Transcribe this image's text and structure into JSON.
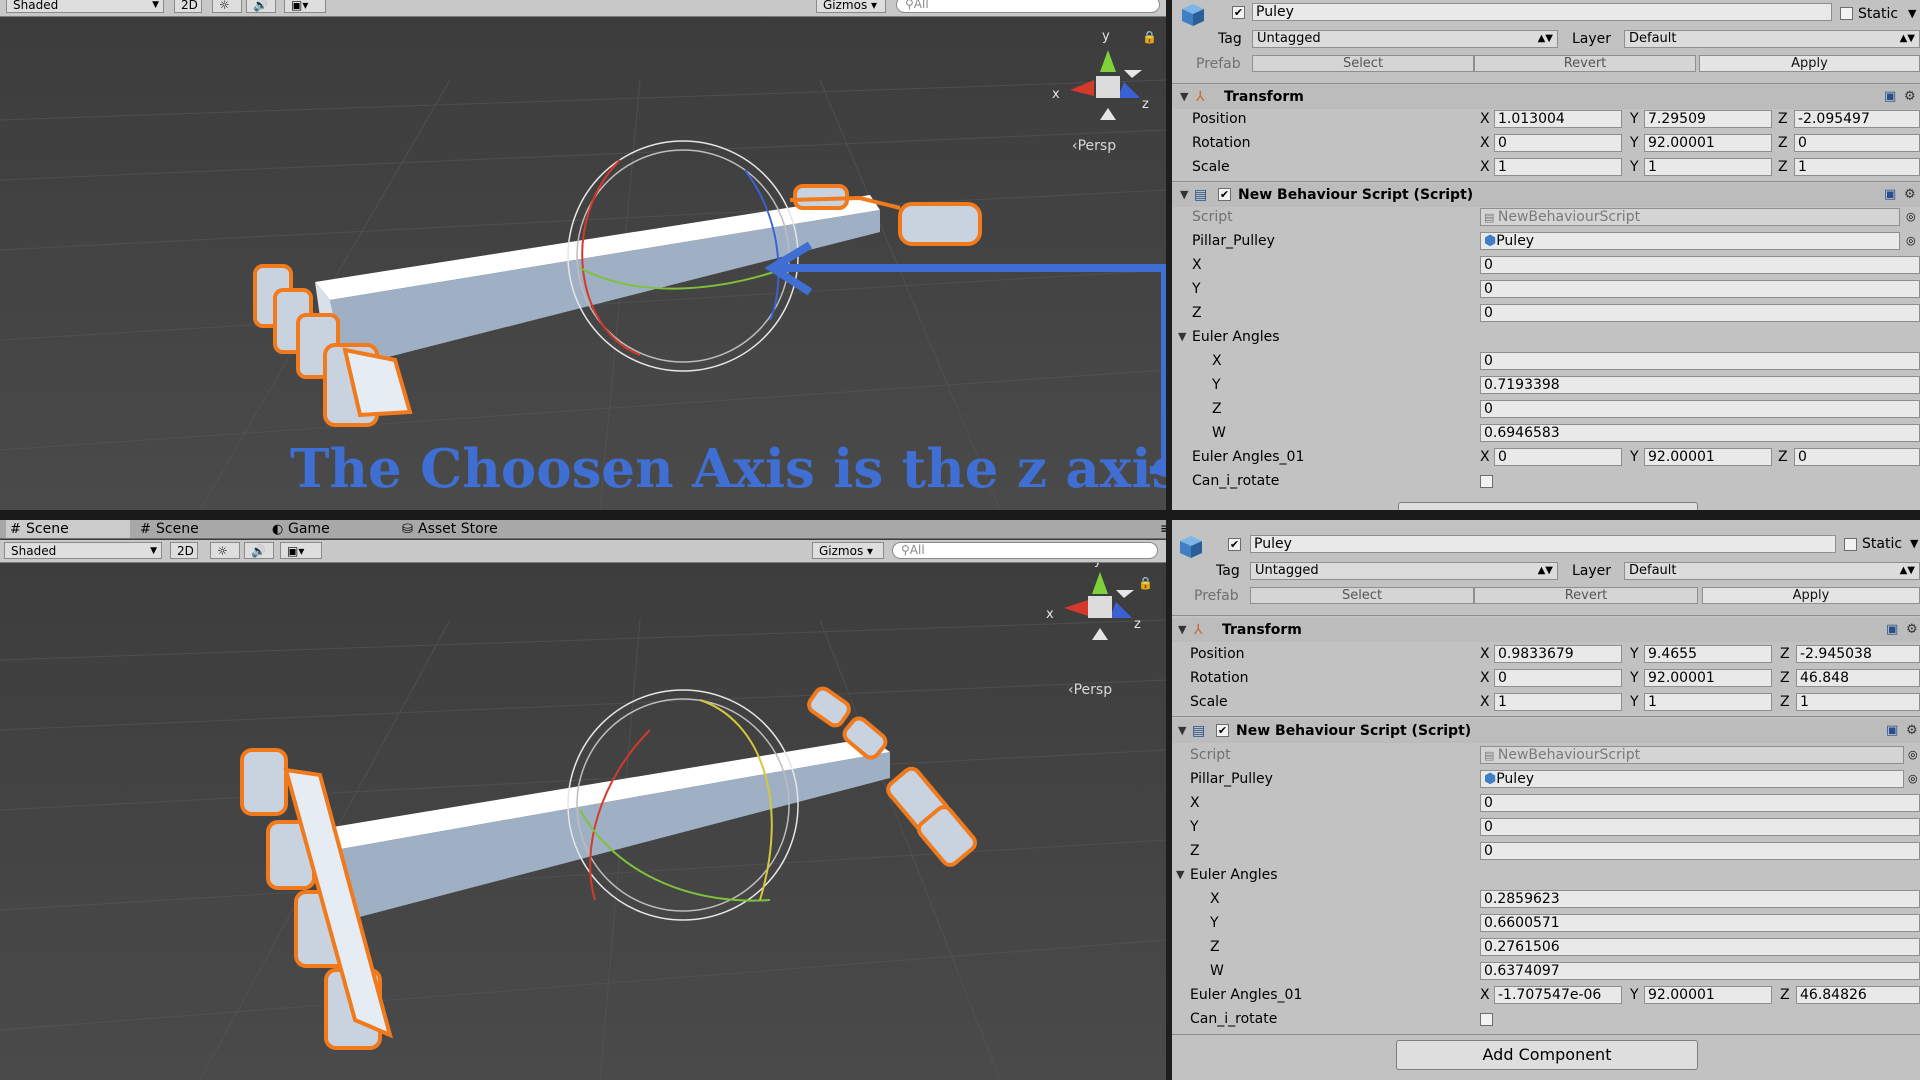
{
  "top": {
    "toolbar": {
      "shaded": "Shaded",
      "mode_2d": "2D",
      "gizmos": "Gizmos",
      "search_placeholder": "All"
    },
    "persp": "Persp",
    "gizmo_axes": {
      "x": "x",
      "y": "y",
      "z": "z"
    },
    "annotation": "The Choosen Axis is the z axis",
    "inspector": {
      "object_name": "Puley",
      "static_label": "Static",
      "tag_label": "Tag",
      "tag_value": "Untagged",
      "layer_label": "Layer",
      "layer_value": "Default",
      "prefab_label": "Prefab",
      "prefab_select": "Select",
      "prefab_revert": "Revert",
      "prefab_apply": "Apply",
      "transform_title": "Transform",
      "position_label": "Position",
      "position": {
        "x": "1.013004",
        "y": "7.29509",
        "z": "-2.095497"
      },
      "rotation_label": "Rotation",
      "rotation": {
        "x": "0",
        "y": "92.00001",
        "z": "0"
      },
      "scale_label": "Scale",
      "scale": {
        "x": "1",
        "y": "1",
        "z": "1"
      },
      "script_title": "New Behaviour Script (Script)",
      "script_label": "Script",
      "script_value": "NewBehaviourScript",
      "pillar_label": "Pillar_Pulley",
      "pillar_value": "Puley",
      "x_label": "X",
      "x_value": "0",
      "y_label": "Y",
      "y_value": "0",
      "z_label": "Z",
      "z_value": "0",
      "euler_label": "Euler Angles",
      "euler": {
        "x": "0",
        "y": "0.7193398",
        "z": "0",
        "w": "0.6946583"
      },
      "euler01_label": "Euler Angles_01",
      "euler01": {
        "x": "0",
        "y": "92.00001",
        "z": "0"
      },
      "can_rotate_label": "Can_i_rotate"
    }
  },
  "bottom": {
    "tabs": [
      {
        "label": "Scene"
      },
      {
        "label": "Scene"
      },
      {
        "label": "Game"
      },
      {
        "label": "Asset Store"
      }
    ],
    "toolbar": {
      "shaded": "Shaded",
      "mode_2d": "2D",
      "gizmos": "Gizmos",
      "search_placeholder": "All"
    },
    "persp": "Persp",
    "gizmo_axes": {
      "x": "x",
      "y": "y",
      "z": "z"
    },
    "inspector": {
      "object_name": "Puley",
      "static_label": "Static",
      "tag_label": "Tag",
      "tag_value": "Untagged",
      "layer_label": "Layer",
      "layer_value": "Default",
      "prefab_label": "Prefab",
      "prefab_select": "Select",
      "prefab_revert": "Revert",
      "prefab_apply": "Apply",
      "transform_title": "Transform",
      "position_label": "Position",
      "position": {
        "x": "0.9833679",
        "y": "9.4655",
        "z": "-2.945038"
      },
      "rotation_label": "Rotation",
      "rotation": {
        "x": "0",
        "y": "92.00001",
        "z": "46.848"
      },
      "scale_label": "Scale",
      "scale": {
        "x": "1",
        "y": "1",
        "z": "1"
      },
      "script_title": "New Behaviour Script (Script)",
      "script_label": "Script",
      "script_value": "NewBehaviourScript",
      "pillar_label": "Pillar_Pulley",
      "pillar_value": "Puley",
      "x_label": "X",
      "x_value": "0",
      "y_label": "Y",
      "y_value": "0",
      "z_label": "Z",
      "z_value": "0",
      "euler_label": "Euler Angles",
      "euler": {
        "x": "0.2859623",
        "y": "0.6600571",
        "z": "0.2761506",
        "w": "0.6374097"
      },
      "euler01_label": "Euler Angles_01",
      "euler01": {
        "x": "-1.707547e-06",
        "y": "92.00001",
        "z": "46.84826"
      },
      "can_rotate_label": "Can_i_rotate",
      "add_component": "Add Component"
    }
  },
  "colors": {
    "annotation": "#3f6fd3",
    "selection": "#f07a1c",
    "scene_bg": "#464646",
    "inspector_bg": "#c2c2c2"
  }
}
